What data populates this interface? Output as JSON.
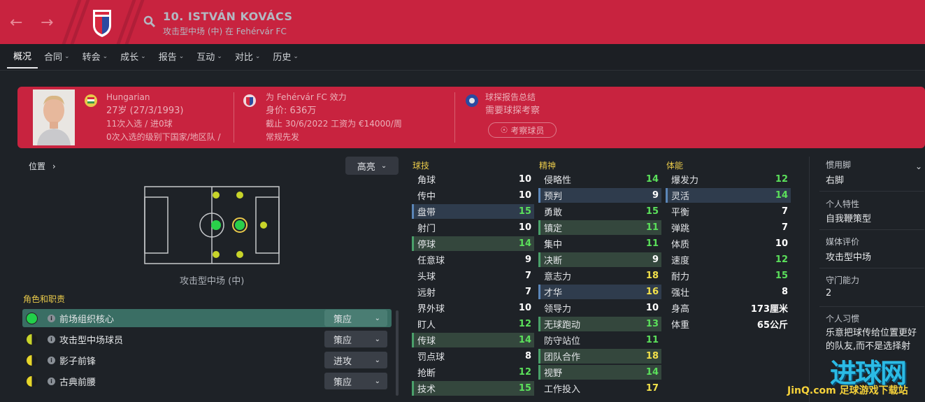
{
  "header": {
    "player_name": "10. ISTVÁN KOVÁCS",
    "player_sub": "攻击型中场 (中) 在 Fehérvár FC",
    "back_icon": "arrow-left-icon",
    "forward_icon": "arrow-right-icon"
  },
  "tabs": [
    {
      "label": "概况"
    },
    {
      "label": "合同"
    },
    {
      "label": "转会"
    },
    {
      "label": "成长"
    },
    {
      "label": "报告"
    },
    {
      "label": "互动"
    },
    {
      "label": "对比"
    },
    {
      "label": "历史"
    }
  ],
  "info": {
    "nationality": "Hungarian",
    "age": "27岁 (27/3/1993)",
    "caps": "11次入选 / 进0球",
    "caps_note": "0次入选的级别下国家/地区队 /",
    "club": "为 Fehérvár FC 效力",
    "value": "身价: 636万",
    "contract": "截止 30/6/2022 工资为 €14000/周",
    "status": "常规先发",
    "scout_title": "球探报告总结",
    "scout_text": "需要球探考察",
    "scout_button": "考察球员"
  },
  "position": {
    "title": "位置",
    "highlight": "高亮",
    "label": "攻击型中场 (中)"
  },
  "roles": {
    "title": "角色和职责",
    "items": [
      {
        "name": "前场组织核心",
        "duty": "策应",
        "color": "#22d04a"
      },
      {
        "name": "攻击型中场球员",
        "duty": "策应",
        "color": "#c8d42a"
      },
      {
        "name": "影子前锋",
        "duty": "进攻",
        "color": "#e6d62a"
      },
      {
        "name": "古典前腰",
        "duty": "策应",
        "color": "#e6d62a"
      }
    ]
  },
  "technical": {
    "title": "球技",
    "rows": [
      {
        "name": "角球",
        "value": "10",
        "hl": "plain",
        "color": "#ffffff"
      },
      {
        "name": "传中",
        "value": "10",
        "hl": "plain",
        "color": "#ffffff"
      },
      {
        "name": "盘带",
        "value": "15",
        "hl": "hl-b",
        "color": "#5be05b"
      },
      {
        "name": "射门",
        "value": "10",
        "hl": "plain",
        "color": "#ffffff"
      },
      {
        "name": "停球",
        "value": "14",
        "hl": "hl-g",
        "color": "#5be05b"
      },
      {
        "name": "任意球",
        "value": "9",
        "hl": "plain",
        "color": "#ffffff"
      },
      {
        "name": "头球",
        "value": "7",
        "hl": "plain",
        "color": "#ffffff"
      },
      {
        "name": "远射",
        "value": "7",
        "hl": "plain",
        "color": "#ffffff"
      },
      {
        "name": "界外球",
        "value": "10",
        "hl": "plain",
        "color": "#ffffff"
      },
      {
        "name": "盯人",
        "value": "12",
        "hl": "plain",
        "color": "#5be05b"
      },
      {
        "name": "传球",
        "value": "14",
        "hl": "hl-g",
        "color": "#5be05b"
      },
      {
        "name": "罚点球",
        "value": "8",
        "hl": "plain",
        "color": "#ffffff"
      },
      {
        "name": "抢断",
        "value": "12",
        "hl": "plain",
        "color": "#5be05b"
      },
      {
        "name": "技术",
        "value": "15",
        "hl": "hl-g",
        "color": "#5be05b"
      }
    ]
  },
  "mental": {
    "title": "精神",
    "rows": [
      {
        "name": "侵略性",
        "value": "14",
        "hl": "plain",
        "color": "#5be05b"
      },
      {
        "name": "预判",
        "value": "9",
        "hl": "hl-b",
        "color": "#ffffff"
      },
      {
        "name": "勇敢",
        "value": "15",
        "hl": "plain",
        "color": "#5be05b"
      },
      {
        "name": "镇定",
        "value": "11",
        "hl": "hl-g",
        "color": "#5be05b"
      },
      {
        "name": "集中",
        "value": "11",
        "hl": "plain",
        "color": "#5be05b"
      },
      {
        "name": "决断",
        "value": "9",
        "hl": "hl-g",
        "color": "#ffffff"
      },
      {
        "name": "意志力",
        "value": "18",
        "hl": "plain",
        "color": "#f2e14a"
      },
      {
        "name": "才华",
        "value": "16",
        "hl": "hl-b",
        "color": "#f2e14a"
      },
      {
        "name": "领导力",
        "value": "10",
        "hl": "plain",
        "color": "#ffffff"
      },
      {
        "name": "无球跑动",
        "value": "13",
        "hl": "hl-g",
        "color": "#5be05b"
      },
      {
        "name": "防守站位",
        "value": "11",
        "hl": "plain",
        "color": "#5be05b"
      },
      {
        "name": "团队合作",
        "value": "18",
        "hl": "hl-g",
        "color": "#f2e14a"
      },
      {
        "name": "视野",
        "value": "14",
        "hl": "hl-g",
        "color": "#5be05b"
      },
      {
        "name": "工作投入",
        "value": "17",
        "hl": "plain",
        "color": "#f2e14a"
      }
    ]
  },
  "physical": {
    "title": "体能",
    "rows": [
      {
        "name": "爆发力",
        "value": "12",
        "hl": "plain",
        "color": "#5be05b"
      },
      {
        "name": "灵活",
        "value": "14",
        "hl": "hl-b",
        "color": "#5be05b"
      },
      {
        "name": "平衡",
        "value": "7",
        "hl": "plain",
        "color": "#ffffff"
      },
      {
        "name": "弹跳",
        "value": "7",
        "hl": "plain",
        "color": "#ffffff"
      },
      {
        "name": "体质",
        "value": "10",
        "hl": "plain",
        "color": "#ffffff"
      },
      {
        "name": "速度",
        "value": "12",
        "hl": "plain",
        "color": "#5be05b"
      },
      {
        "name": "耐力",
        "value": "15",
        "hl": "plain",
        "color": "#5be05b"
      },
      {
        "name": "强壮",
        "value": "8",
        "hl": "plain",
        "color": "#ffffff"
      },
      {
        "name": "身高",
        "value": "173厘米",
        "hl": "plain",
        "color": "#ffffff"
      },
      {
        "name": "体重",
        "value": "65公斤",
        "hl": "plain",
        "color": "#ffffff"
      }
    ]
  },
  "side": {
    "foot_label": "惯用脚",
    "foot_value": "右脚",
    "traits_label": "个人特性",
    "traits_value": "自我鞭策型",
    "media_label": "媒体评价",
    "media_value": "攻击型中场",
    "gk_label": "守门能力",
    "gk_value": "2",
    "habits_label": "个人习惯",
    "habits_value": "乐意把球传给位置更好的队友,而不是选择射"
  },
  "watermark": {
    "big": "进球网",
    "small": "JinQ.com 足球游戏下载站"
  }
}
